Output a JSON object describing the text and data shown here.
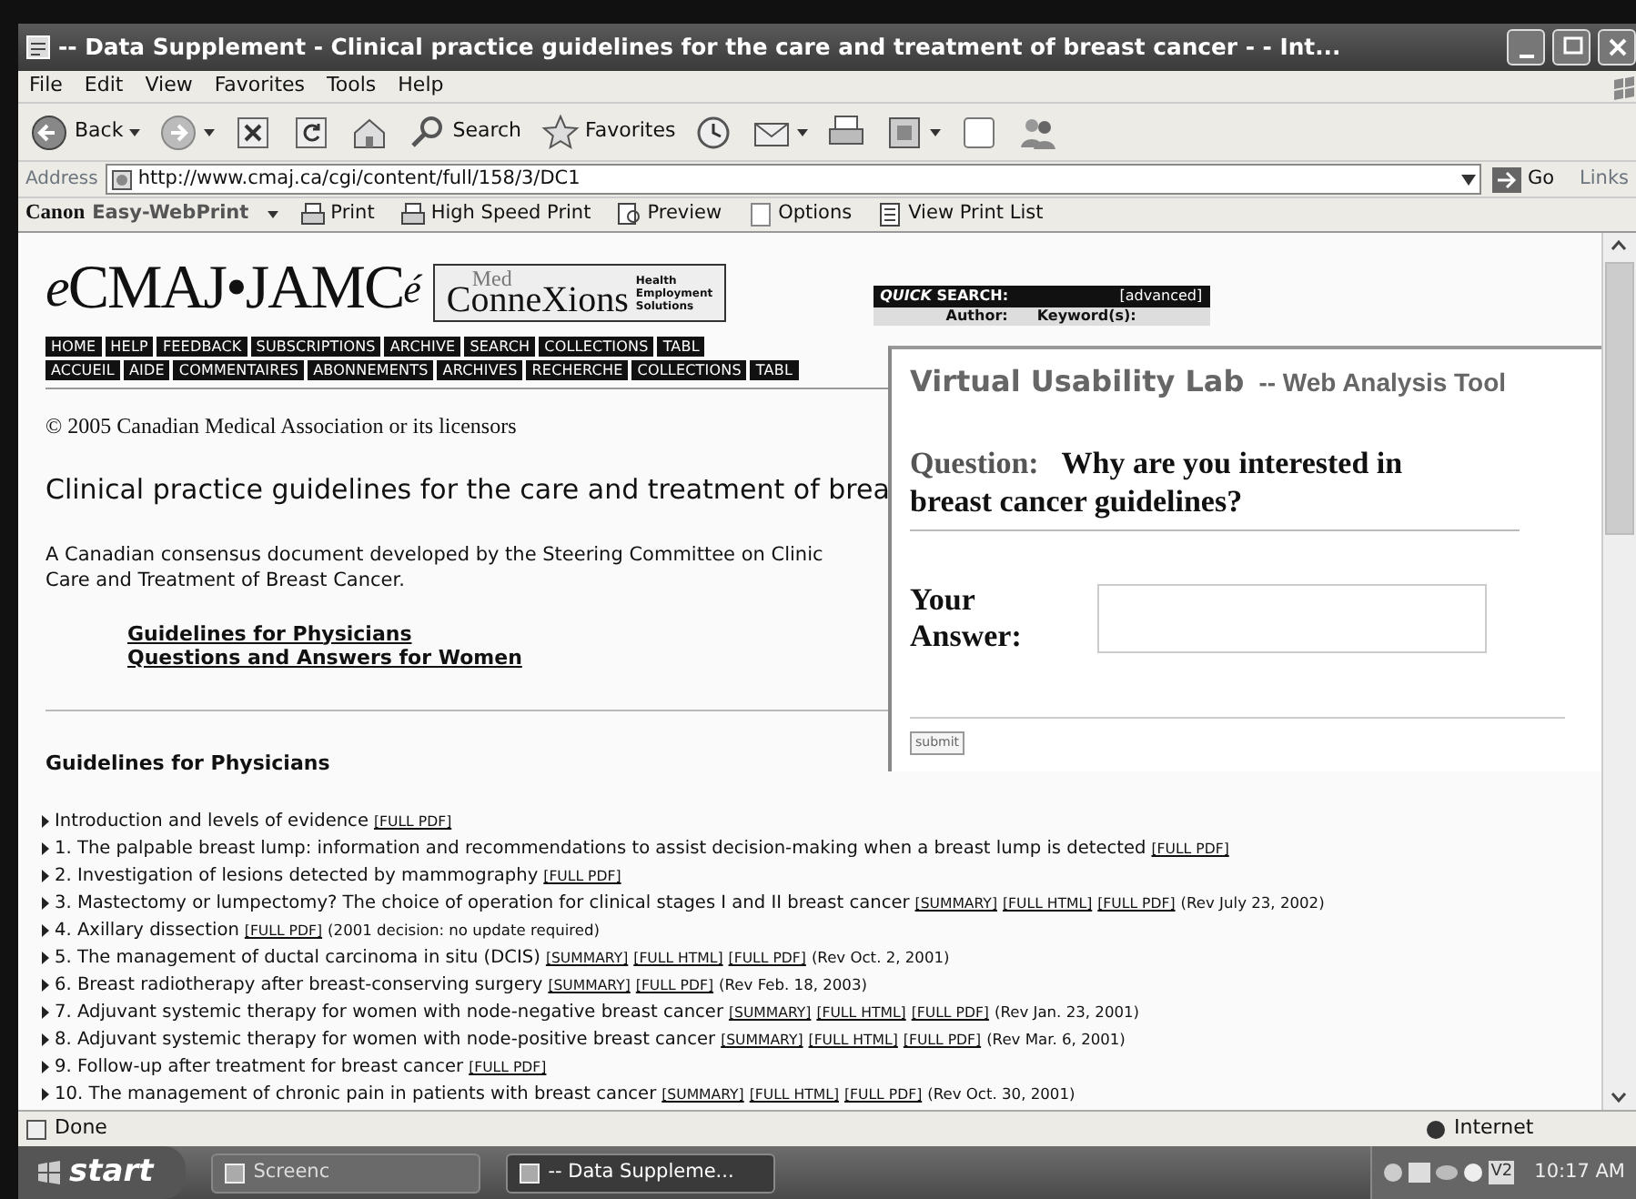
{
  "window": {
    "title": "-- Data Supplement - Clinical practice guidelines for the care and treatment of breast cancer - - Int..."
  },
  "menu": [
    "File",
    "Edit",
    "View",
    "Favorites",
    "Tools",
    "Help"
  ],
  "toolbar": [
    {
      "kind": "back",
      "label": "Back"
    },
    {
      "kind": "forward"
    },
    {
      "kind": "stop"
    },
    {
      "kind": "refresh"
    },
    {
      "kind": "home"
    },
    {
      "kind": "search",
      "label": "Search"
    },
    {
      "kind": "favorites",
      "label": "Favorites"
    },
    {
      "kind": "history"
    },
    {
      "kind": "mail"
    },
    {
      "kind": "print"
    },
    {
      "kind": "edit"
    },
    {
      "kind": "discuss"
    },
    {
      "kind": "messenger"
    }
  ],
  "address": {
    "label": "Address",
    "value": "http://www.cmaj.ca/cgi/content/full/158/3/DC1",
    "go": "Go",
    "links": "Links"
  },
  "print_bar": {
    "brand": "Canon",
    "product": "Easy-WebPrint",
    "buttons": [
      {
        "kind": "print",
        "label": "Print"
      },
      {
        "kind": "print",
        "label": "High Speed Print"
      },
      {
        "kind": "preview",
        "label": "Preview"
      },
      {
        "kind": "options",
        "label": "Options"
      },
      {
        "kind": "list",
        "label": "View Print List"
      }
    ]
  },
  "page": {
    "logo": {
      "prefix": "e",
      "name": "CMAJ•JAMC",
      "suffix": "é"
    },
    "banner": {
      "top": "Med",
      "name": "ConneXions",
      "tagline": [
        "Health",
        "Employment",
        "Solutions"
      ]
    },
    "quick_search": {
      "title_em": "QUICK",
      "title": "SEARCH:",
      "advanced": "[advanced]",
      "fields": [
        "Author:",
        "Keyword(s):"
      ]
    },
    "nav_rows": [
      [
        "HOME",
        "HELP",
        "FEEDBACK",
        "SUBSCRIPTIONS",
        "ARCHIVE",
        "SEARCH",
        "COLLECTIONS",
        "TABL"
      ],
      [
        "ACCUEIL",
        "AIDE",
        "COMMENTAIRES",
        "ABONNEMENTS",
        "ARCHIVES",
        "RECHERCHE",
        "COLLECTIONS",
        "TABL"
      ]
    ],
    "copyright": {
      "before": "© 2005 ",
      "link": "Canadian Medical Association",
      "after": " or its licensors"
    },
    "heading": "Clinical practice guidelines for the care and treatment of brea",
    "intro": {
      "before": "A Canadian consensus document developed by the ",
      "link_1": "Steering Committee on Clinic",
      "link_2": "Care and Treatment of Breast Cancer",
      "after": "."
    },
    "anchors": [
      "Guidelines for Physicians",
      "Questions and Answers for Women"
    ],
    "section": "Guidelines for Physicians",
    "items": [
      {
        "text": "Introduction and levels of evidence",
        "links": [
          "[FULL PDF]"
        ]
      },
      {
        "text": "1. The palpable breast lump: information and recommendations to assist decision-making when a breast lump is detected",
        "links": [
          "[FULL PDF]"
        ]
      },
      {
        "text": "2. Investigation of lesions detected by mammography",
        "links": [
          "[FULL PDF]"
        ]
      },
      {
        "text": "3. Mastectomy or lumpectomy? The choice of operation for clinical stages I and II breast cancer",
        "links": [
          "[SUMMARY]",
          "[FULL HTML]",
          "[FULL PDF]"
        ],
        "note": "(Rev July 23, 2002)"
      },
      {
        "text": "4. Axillary dissection",
        "links": [
          "[FULL PDF]"
        ],
        "note": "(2001 decision: no update required)"
      },
      {
        "text": "5. The management of ductal carcinoma in situ (DCIS)",
        "links": [
          "[SUMMARY]",
          "[FULL HTML]",
          "[FULL PDF]"
        ],
        "note": "(Rev Oct. 2, 2001)"
      },
      {
        "text": "6. Breast radiotherapy after breast-conserving surgery",
        "links": [
          "[SUMMARY]",
          "[FULL PDF]"
        ],
        "note": "(Rev Feb. 18, 2003)"
      },
      {
        "text": "7. Adjuvant systemic therapy for women with node-negative breast cancer",
        "links": [
          "[SUMMARY]",
          "[FULL HTML]",
          "[FULL PDF]"
        ],
        "note": "(Rev Jan. 23, 2001)"
      },
      {
        "text": "8. Adjuvant systemic therapy for women with node-positive breast cancer",
        "links": [
          "[SUMMARY]",
          "[FULL HTML]",
          "[FULL PDF]"
        ],
        "note": "(Rev Mar. 6, 2001)"
      },
      {
        "text": "9. Follow-up after treatment for breast cancer",
        "links": [
          "[FULL PDF]"
        ]
      },
      {
        "text": "10. The management of chronic pain in patients with breast cancer",
        "links": [
          "[SUMMARY]",
          "[FULL HTML]",
          "[FULL PDF]"
        ],
        "note": "(Rev Oct. 30, 2001)"
      }
    ]
  },
  "popup": {
    "title": "Virtual Usability Lab",
    "subtitle": "-- Web Analysis Tool",
    "question_label": "Question:",
    "question": "Why are you interested in breast cancer guidelines?",
    "answer_label": "Your Answer:",
    "submit": "submit"
  },
  "status_bar": {
    "text": "Done",
    "zone": "Internet"
  },
  "taskbar": {
    "start": "start",
    "tasks": [
      {
        "label": "Screenc",
        "selected": false
      },
      {
        "label": "-- Data Suppleme...",
        "selected": true
      }
    ],
    "tray_badge": "V2",
    "clock": "10:17 AM"
  }
}
